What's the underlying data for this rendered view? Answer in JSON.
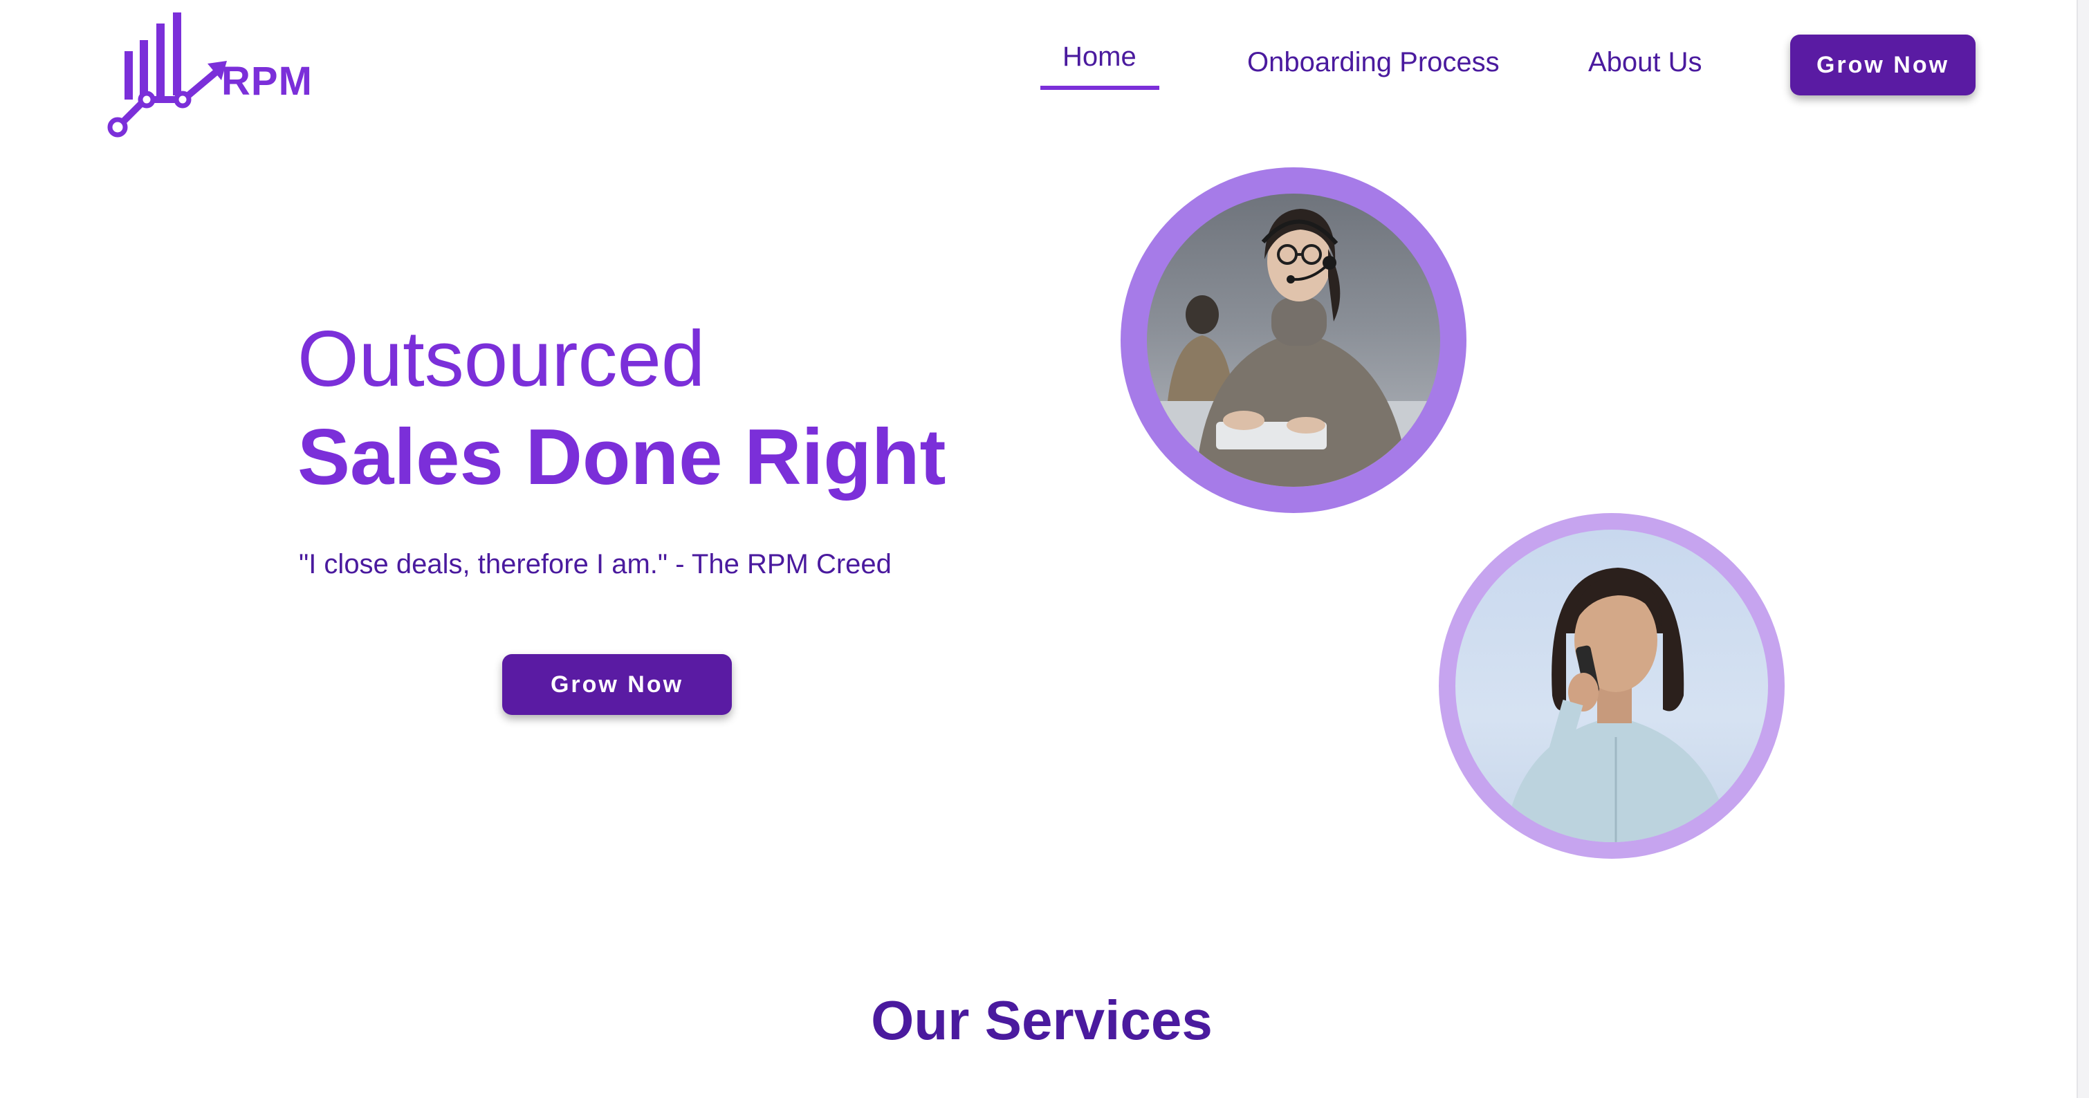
{
  "brand": {
    "name": "RPM",
    "accent_color": "#7b2fd9",
    "dark_color": "#5a1ba3",
    "icon": "bar-chart-arrow-logo"
  },
  "nav": {
    "items": [
      {
        "label": "Home",
        "active": true
      },
      {
        "label": "Onboarding Process",
        "active": false
      },
      {
        "label": "About Us",
        "active": false
      }
    ],
    "cta_label": "Grow Now"
  },
  "hero": {
    "line1": "Outsourced",
    "line2": "Sales Done Right",
    "quote": "\"I close deals, therefore I am.\" - The RPM Creed",
    "cta_label": "Grow Now",
    "images": [
      {
        "name": "woman-with-headset-photo"
      },
      {
        "name": "woman-on-phone-photo"
      }
    ]
  },
  "services": {
    "title": "Our Services"
  }
}
